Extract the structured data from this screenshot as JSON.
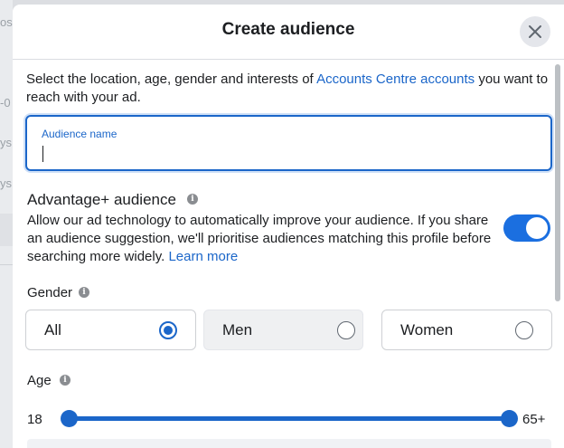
{
  "background": {
    "fragments": [
      "os",
      "-0",
      "ys",
      "ys"
    ]
  },
  "modal": {
    "title": "Create audience",
    "close_icon": "close-icon"
  },
  "description": {
    "prefix": "Select the location, age, gender and interests of ",
    "link": "Accounts Centre accounts",
    "suffix": " you want to reach with your ad."
  },
  "audience_name": {
    "label": "Audience name",
    "value": ""
  },
  "advantage": {
    "title": "Advantage+ audience",
    "info_icon": "info-icon",
    "description": "Allow our ad technology to automatically improve your audience. If you share an audience suggestion, we'll prioritise audiences matching this profile before searching more widely. ",
    "learn_more": "Learn more",
    "enabled": true
  },
  "gender": {
    "label": "Gender",
    "info_icon": "info-icon",
    "options": [
      {
        "label": "All",
        "selected": true
      },
      {
        "label": "Men",
        "selected": false
      },
      {
        "label": "Women",
        "selected": false
      }
    ]
  },
  "age": {
    "label": "Age",
    "info_icon": "info-icon",
    "min": "18",
    "max": "65+"
  },
  "colors": {
    "accent": "#1b66c9",
    "toggle_on": "#1b6fe0"
  }
}
